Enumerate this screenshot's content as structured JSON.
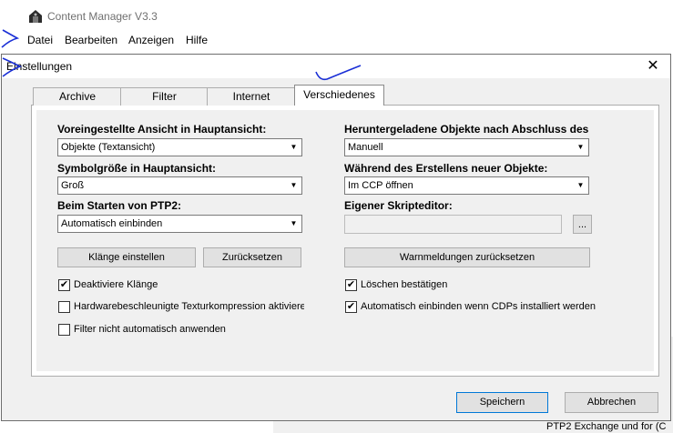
{
  "app": {
    "title": "Content Manager V3.3"
  },
  "menu": [
    "Datei",
    "Bearbeiten",
    "Anzeigen",
    "Hilfe"
  ],
  "dialog": {
    "title": "Einstellungen",
    "close_glyph": "✕",
    "tabs": [
      "Archive",
      "Filter",
      "Internet",
      "Verschiedenes"
    ],
    "active_tab": "Verschiedenes",
    "left": {
      "view_label": "Voreingestellte Ansicht in Hauptansicht:",
      "view_value": "Objekte (Textansicht)",
      "icon_size_label": "Symbolgröße in Hauptansicht:",
      "icon_size_value": "Groß",
      "start_label": "Beim Starten von PTP2:",
      "start_value": "Automatisch einbinden",
      "sounds_button": "Klänge einstellen",
      "reset_button": "Zurücksetzen",
      "checkboxes": [
        {
          "label": "Deaktiviere Klänge",
          "checked": true
        },
        {
          "label": "Hardwarebeschleunigte Texturkompression aktivieren",
          "checked": false
        },
        {
          "label": "Filter nicht automatisch anwenden",
          "checked": false
        }
      ]
    },
    "right": {
      "download_label": "Heruntergeladene Objekte nach Abschluss des",
      "download_value": "Manuell",
      "create_label": "Während des Erstellens neuer Objekte:",
      "create_value": "Im CCP öffnen",
      "script_label": "Eigener Skripteditor:",
      "script_value": "",
      "ellipsis": "...",
      "warnings_button": "Warnmeldungen zurücksetzen",
      "checkboxes": [
        {
          "label": "Löschen bestätigen",
          "checked": true
        },
        {
          "label": "Automatisch einbinden wenn CDPs installiert werden",
          "checked": true
        }
      ]
    },
    "save_button": "Speichern",
    "cancel_button": "Abbrechen"
  },
  "background": {
    "status_text": "PTP2 Exchange und for (C"
  },
  "colors": {
    "annotation": "#1a2fd6",
    "focus_border": "#0078d7",
    "dialog_bg": "#f0f0f0"
  },
  "icons": {
    "app": "app-logo-icon",
    "dropdown": "chevron-down-icon",
    "check": "checkmark-icon"
  }
}
